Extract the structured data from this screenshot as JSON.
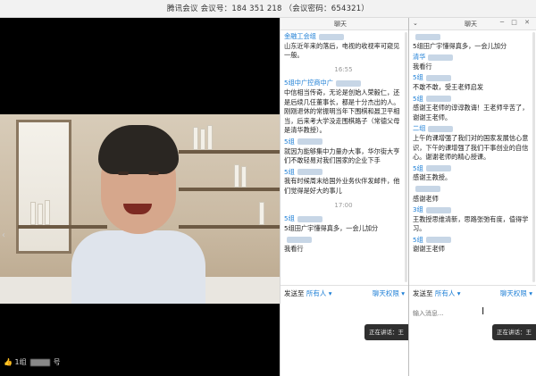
{
  "titlebar": {
    "title": "腾讯会议  会议号：184 351 218  （会议密码：654321）"
  },
  "video": {
    "thumb_prefix": "1组",
    "thumb_suffix": "号"
  },
  "chat_a": {
    "header": "聊天",
    "messages": [
      {
        "name": "金融工会组",
        "text": "山东近年来的落后，电视的收视率可窥见一般。"
      },
      {
        "time": "16:55"
      },
      {
        "name": "5组中广控商中广",
        "text": "中信相当传奇，无论是创始人荣毅仁，还是后续几任董事长，都是十分杰出的人。刚刚退休的常振明当年下围棋和聂卫平相当，后来考大学没走围棋路子（常德父母是清华教授）。"
      },
      {
        "name": "5组",
        "text": "就因为能够集中力量办大事，华尔街大亨们不敢轻易对我们国家的企业下手"
      },
      {
        "name": "5组",
        "text": "我有时候周末给国外业务伙伴发邮件，他们觉得是好大的事儿"
      },
      {
        "time": "17:00"
      },
      {
        "name": "5组",
        "text": "5组田广宇懂得真多，一会儿加分"
      },
      {
        "name": "",
        "text": "我看行"
      }
    ],
    "send_to": "发送至",
    "send_target": "所有人 ▾",
    "permission": "聊天权限 ▾",
    "placeholder": "",
    "toast": "正在讲话：王"
  },
  "chat_b": {
    "header": "聊天",
    "messages": [
      {
        "name": "",
        "text": "5组田广宇懂得真多，一会儿加分"
      },
      {
        "name": "清华",
        "text": "我看行"
      },
      {
        "name": "5组",
        "text": "不敢不敢，受王老师启发"
      },
      {
        "name": "5组",
        "text": "感谢王老师的谆谆教诲！王老师辛苦了，谢谢王老师。"
      },
      {
        "name": "二组",
        "text": "上午的课增强了我们对的国家发展信心意识，下午的课增强了我们干事创业的自信心。谢谢老师的精心授课。"
      },
      {
        "name": "5组",
        "text": "感谢王教授。"
      },
      {
        "name": "",
        "text": "感谢老师"
      },
      {
        "name": "3组",
        "text": "王教授思维清新，思路张弛有度，值得学习。"
      },
      {
        "name": "5组",
        "text": "谢谢王老师"
      }
    ],
    "send_to": "发送至",
    "send_target": "所有人 ▾",
    "permission": "聊天权限 ▾",
    "placeholder": "输入消息...",
    "toast": "正在讲话：王"
  }
}
